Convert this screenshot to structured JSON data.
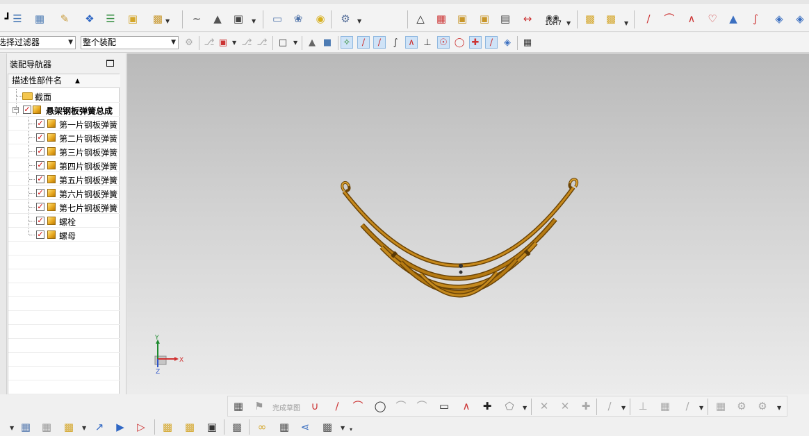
{
  "selection_bar": {
    "type_filter_value": "选择过滤器",
    "scope_value": "整个装配"
  },
  "navigator": {
    "title": "装配导航器",
    "column_header": "描述性部件名",
    "section_node": "截面",
    "root_node": "悬架钢板弹簧总成",
    "children": [
      "第一片钢板弹簧",
      "第二片钢板弹簧",
      "第三片钢板弹簧",
      "第四片钢板弹簧",
      "第五片钢板弹簧",
      "第六片钢板弹簧",
      "第七片钢板弹簧",
      "螺栓",
      "螺母"
    ]
  },
  "toolbar": {
    "fit_tolerance_label": "10H7"
  },
  "sketch_toolbar": {
    "finish_sketch_label": "完成草图"
  },
  "triad": {
    "x_label": "X",
    "y_label": "Y",
    "z_label": "Z"
  },
  "colors": {
    "spring_body": "#b57a12",
    "spring_dark": "#6b4406",
    "check_red": "#d00000",
    "axis_x": "#d03030",
    "axis_y": "#1d8a2e",
    "axis_z": "#2a52c8"
  }
}
